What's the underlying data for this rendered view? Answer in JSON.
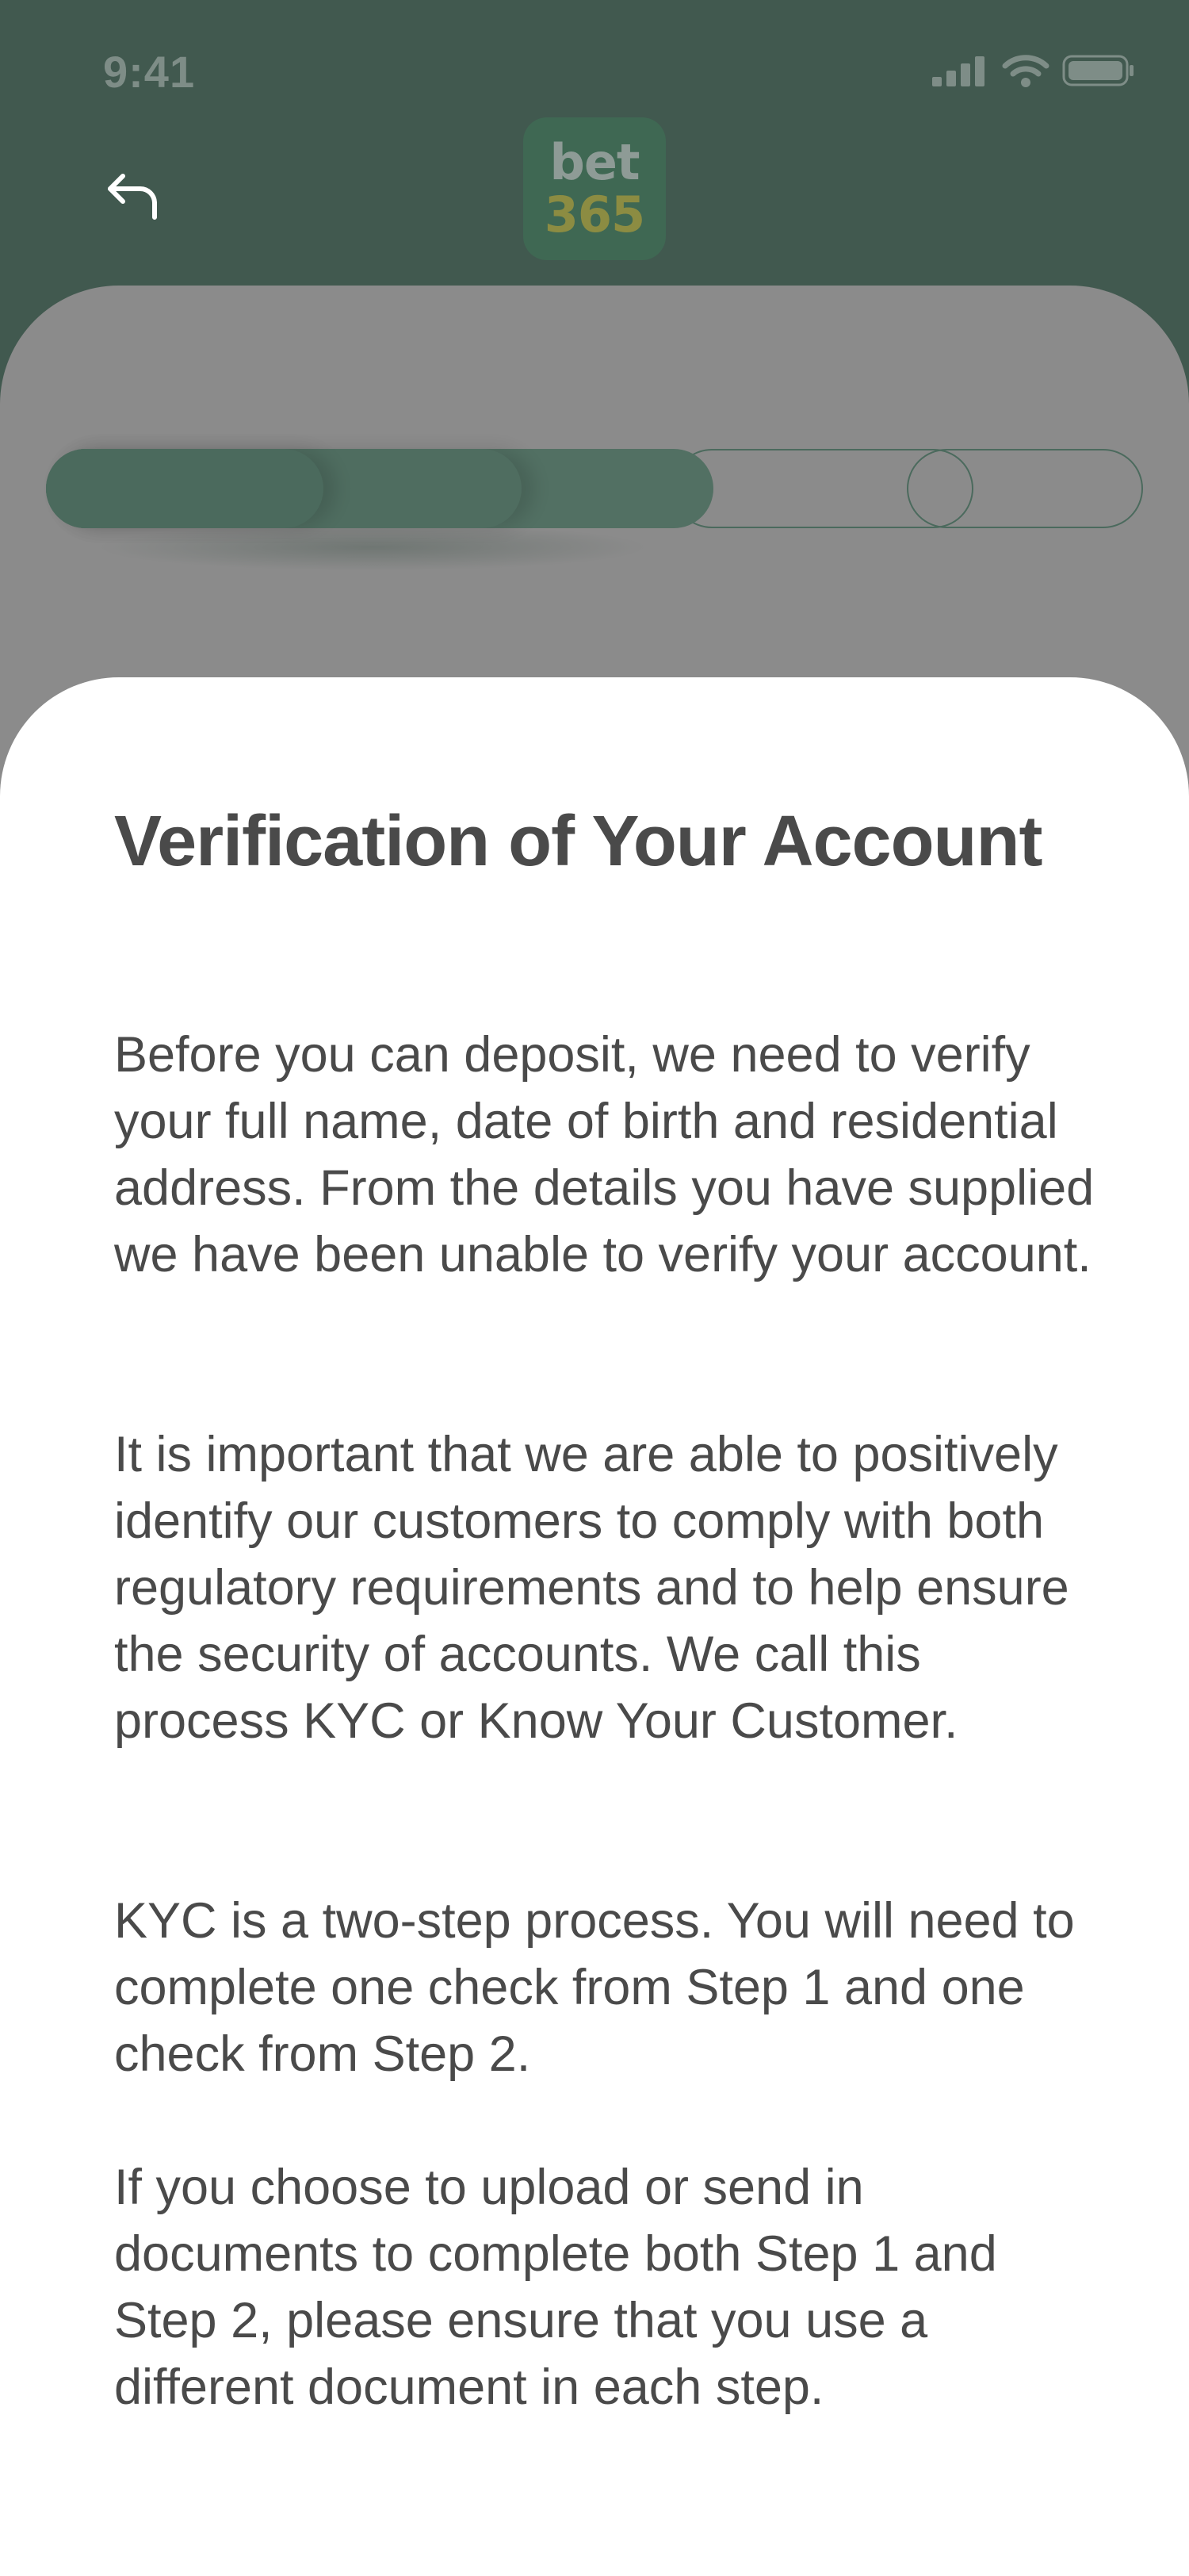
{
  "status_bar": {
    "time": "9:41",
    "icons": [
      "signal-icon",
      "wifi-icon",
      "battery-icon"
    ]
  },
  "header": {
    "back_icon": "back-arrow-icon",
    "logo_line1": "bet",
    "logo_line2": "365"
  },
  "progress": {
    "total_steps": 5,
    "completed_steps": 3
  },
  "content": {
    "title": "Verification of Your Account",
    "paragraphs": [
      "Before you can deposit, we need to verify your full name, date of birth and residential address. From the details you have supplied we have been unable to verify your account.",
      "It is important that we are able to positively identify our customers to comply with both regulatory requirements and to help ensure the security of accounts. We call this process KYC or Know Your Customer.",
      "KYC is a two-step process. You will need to complete one check from Step 1 and one check from Step 2.",
      "If you choose to upload or send in documents to complete both Step 1 and Step 2, please ensure that you use a different document in each step."
    ]
  },
  "colors": {
    "header_bg": "#41594f",
    "progress_fill": "#4b6a5d",
    "logo_bg": "#3f6853",
    "logo_accent": "#8c8c42",
    "text": "#4a4a4a"
  }
}
